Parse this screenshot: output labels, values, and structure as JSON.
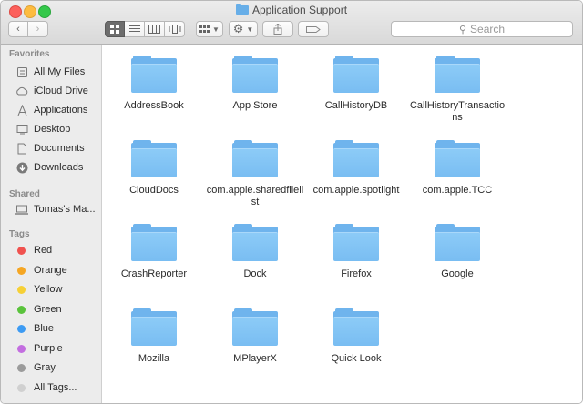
{
  "window": {
    "title": "Application Support"
  },
  "toolbar": {
    "back_icon": "chevron-left",
    "forward_icon": "chevron-right",
    "view_modes": [
      "icon-view",
      "list-view",
      "column-view",
      "coverflow-view"
    ],
    "active_view": "icon-view",
    "search_placeholder": "Search"
  },
  "sidebar": {
    "favorites_header": "Favorites",
    "favorites": [
      {
        "label": "All My Files",
        "icon": "all-files-icon"
      },
      {
        "label": "iCloud Drive",
        "icon": "cloud-icon"
      },
      {
        "label": "Applications",
        "icon": "applications-icon"
      },
      {
        "label": "Desktop",
        "icon": "desktop-icon"
      },
      {
        "label": "Documents",
        "icon": "documents-icon"
      },
      {
        "label": "Downloads",
        "icon": "downloads-icon"
      }
    ],
    "shared_header": "Shared",
    "shared": [
      {
        "label": "Tomas's Ma...",
        "icon": "computer-icon"
      }
    ],
    "tags_header": "Tags",
    "tags": [
      {
        "label": "Red",
        "color": "#f0524f"
      },
      {
        "label": "Orange",
        "color": "#f5a623"
      },
      {
        "label": "Yellow",
        "color": "#f6d036"
      },
      {
        "label": "Green",
        "color": "#5ac33c"
      },
      {
        "label": "Blue",
        "color": "#3d9bf3"
      },
      {
        "label": "Purple",
        "color": "#c36ee0"
      },
      {
        "label": "Gray",
        "color": "#9b9b9b"
      },
      {
        "label": "All Tags...",
        "color": "#d0d0d0"
      }
    ]
  },
  "folders": [
    "AddressBook",
    "App Store",
    "CallHistoryDB",
    "CallHistoryTransactions",
    "CloudDocs",
    "com.apple.sharedfilelist",
    "com.apple.spotlight",
    "com.apple.TCC",
    "CrashReporter",
    "Dock",
    "Firefox",
    "Google",
    "Mozilla",
    "MPlayerX",
    "Quick Look"
  ],
  "colors": {
    "folder": "#79bdf2",
    "sidebar_bg": "#ececec"
  }
}
